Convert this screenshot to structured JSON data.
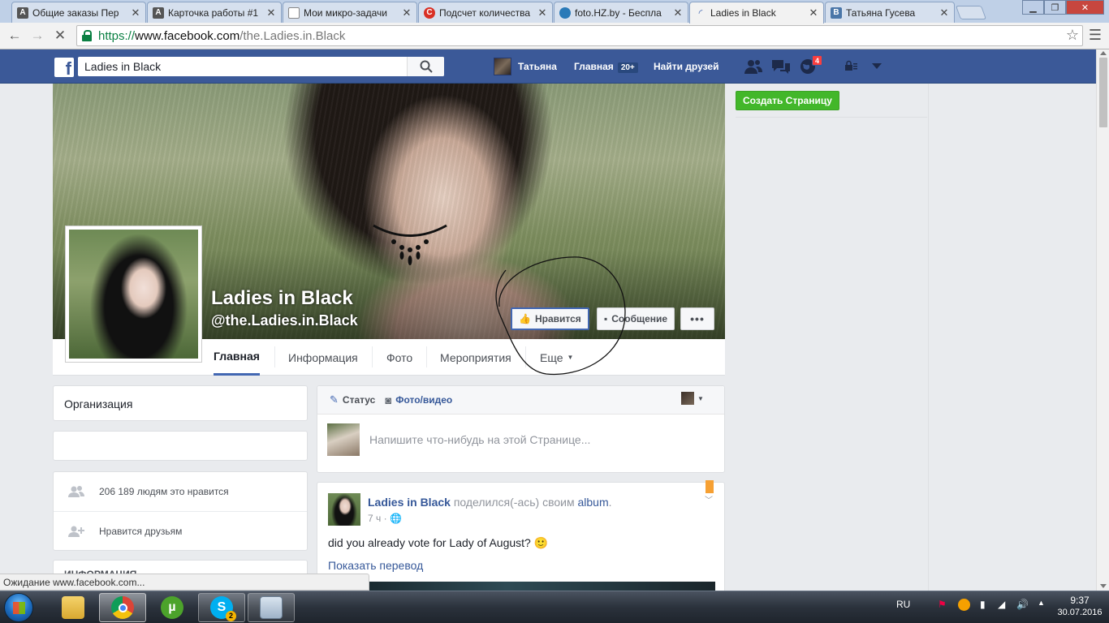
{
  "browser": {
    "tabs": [
      {
        "title": "Общие заказы Пер",
        "favicon": "A",
        "favicon_color": "#555555"
      },
      {
        "title": "Карточка работы #1",
        "favicon": "A",
        "favicon_color": "#555555"
      },
      {
        "title": "Мои микро-задачи",
        "favicon": "",
        "favicon_color": "#ffffff"
      },
      {
        "title": "Подсчет количества",
        "favicon": "C",
        "favicon_color": "#d93025"
      },
      {
        "title": "foto.HZ.by - Беспла",
        "favicon": "",
        "favicon_color": "#2a7ab8"
      },
      {
        "title": "Ladies in Black",
        "favicon": "",
        "favicon_color": "#4267b2"
      },
      {
        "title": "Татьяна Гусева",
        "favicon": "B",
        "favicon_color": "#4a76a8"
      }
    ],
    "url_https": "https://",
    "url_host": "www.facebook.com",
    "url_path": "/the.Ladies.in.Black",
    "status_tip": "Ожидание www.facebook.com..."
  },
  "fb_header": {
    "search_value": "Ladies in Black",
    "user_name": "Татьяна",
    "home_label": "Главная",
    "home_count": "20+",
    "find_friends": "Найти друзей",
    "notif_count": "4"
  },
  "page": {
    "name": "Ladies in Black",
    "handle": "@the.Ladies.in.Black",
    "like_label": "Нравится",
    "message_label": "Сообщение",
    "more_label": "•••",
    "tabs": [
      "Главная",
      "Информация",
      "Фото",
      "Мероприятия",
      "Еще"
    ],
    "create_page": "Создать Страницу"
  },
  "sidebar": {
    "category": "Организация",
    "likes_text": "206 189 людям это нравится",
    "friends_like_text": "Нравится друзьям",
    "info_header": "ИНФОРМАЦИЯ"
  },
  "composer": {
    "status_label": "Статус",
    "photo_label": "Фото/видео",
    "placeholder": "Напишите что-нибудь на этой Странице..."
  },
  "post": {
    "author": "Ladies in Black",
    "shared_text": "поделился(-ась) своим",
    "album_link": "album",
    "time": "7 ч",
    "text": "did you already vote for Lady of August? 🙂",
    "translate": "Показать перевод"
  },
  "taskbar": {
    "lang": "RU",
    "time": "9:37",
    "date": "30.07.2016",
    "apps": [
      "explorer",
      "chrome",
      "utorrent",
      "skype",
      "calculator"
    ],
    "skype_badge": "2"
  },
  "colors": {
    "fb_blue": "#3b5998",
    "link_blue": "#365899",
    "green_button": "#42b72a"
  }
}
